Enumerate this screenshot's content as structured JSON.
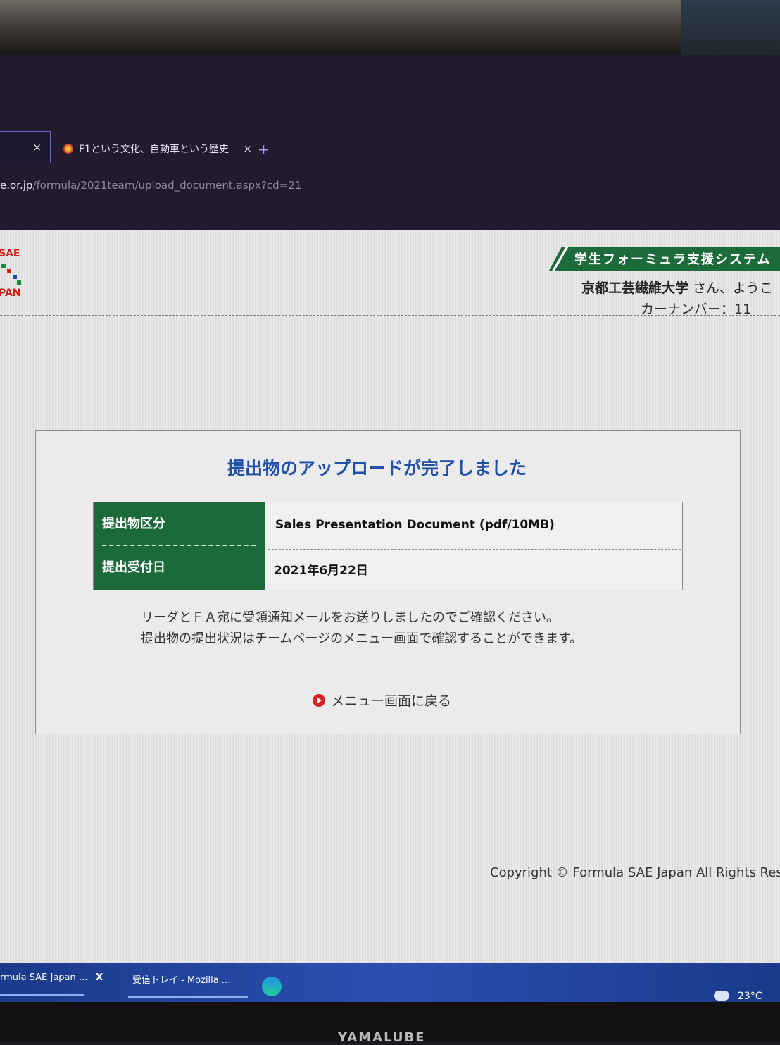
{
  "browser": {
    "tabs": [
      {
        "label": "",
        "close": "×"
      },
      {
        "label": "F1という文化、自動車という歴史",
        "close": "×"
      }
    ],
    "new_tab": "+",
    "url_domain": "e.or.jp",
    "url_path": "/formula/2021team/upload_document.aspx?cd=21"
  },
  "header": {
    "logo_top": "SAE",
    "logo_bottom": "PAN",
    "system_title": "学生フォーミュラ支援システム",
    "university": "京都工芸繊維大学",
    "welcome_suffix": " さん、ようこ",
    "car_number": "カーナンバー：11"
  },
  "panel": {
    "title": "提出物のアップロードが完了しました",
    "rows": [
      {
        "label": "提出物区分",
        "value": "Sales Presentation Document (pdf/10MB)"
      },
      {
        "label": "提出受付日",
        "value": "2021年6月22日"
      }
    ],
    "message_line1": "リーダとＦＡ宛に受領通知メールをお送りしましたのでご確認ください。",
    "message_line2": "提出物の提出状況はチームページのメニュー画面で確認することができます。",
    "back_link": "メニュー画面に戻る"
  },
  "footer": {
    "copyright": "Copyright © Formula SAE Japan All Rights Res"
  },
  "taskbar": {
    "items": [
      "rmula SAE Japan ...",
      "X",
      "受信トレイ - Mozilla ..."
    ],
    "temperature": "23°C"
  },
  "monitor": {
    "brand": "YAMALUBE"
  },
  "colors": {
    "accent_green": "#1a6a3a",
    "title_blue": "#1f4fa8",
    "link_red": "#d8222a"
  }
}
